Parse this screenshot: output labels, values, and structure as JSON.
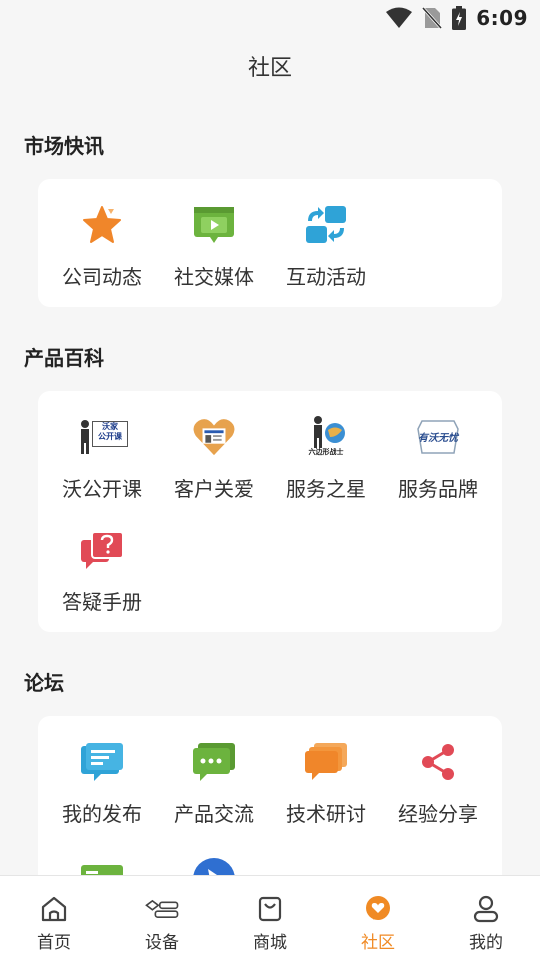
{
  "status": {
    "time": "6:09"
  },
  "header": {
    "title": "社区"
  },
  "sections": [
    {
      "title": "市场快讯",
      "items": [
        {
          "label": "公司动态",
          "icon": "star-icon"
        },
        {
          "label": "社交媒体",
          "icon": "video-icon"
        },
        {
          "label": "互动活动",
          "icon": "swap-icon"
        }
      ]
    },
    {
      "title": "产品百科",
      "items": [
        {
          "label": "沃公开课",
          "icon": "course-logo-icon"
        },
        {
          "label": "客户关爱",
          "icon": "heart-logo-icon"
        },
        {
          "label": "服务之星",
          "icon": "service-star-logo-icon"
        },
        {
          "label": "服务品牌",
          "icon": "brand-logo-icon"
        },
        {
          "label": "答疑手册",
          "icon": "question-chat-icon"
        }
      ]
    },
    {
      "title": "论坛",
      "items": [
        {
          "label": "我的发布",
          "icon": "chat-text-icon"
        },
        {
          "label": "产品交流",
          "icon": "chat-dots-icon"
        },
        {
          "label": "技术研讨",
          "icon": "chat-stack-icon"
        },
        {
          "label": "经验分享",
          "icon": "share-icon"
        }
      ]
    }
  ],
  "logo_text": {
    "course": [
      "沃家",
      "公开课"
    ],
    "service_star": "六边形战士",
    "brand": "有沃无忧"
  },
  "bottom_nav": [
    {
      "label": "首页",
      "icon": "home-icon"
    },
    {
      "label": "设备",
      "icon": "device-icon"
    },
    {
      "label": "商城",
      "icon": "shop-bag-icon"
    },
    {
      "label": "社区",
      "icon": "community-icon",
      "active": true
    },
    {
      "label": "我的",
      "icon": "profile-icon"
    }
  ],
  "colors": {
    "accent": "#f08a24",
    "orange": "#f0862a",
    "green": "#6cb33e",
    "blue": "#2fa3d7",
    "red": "#e14a56"
  }
}
